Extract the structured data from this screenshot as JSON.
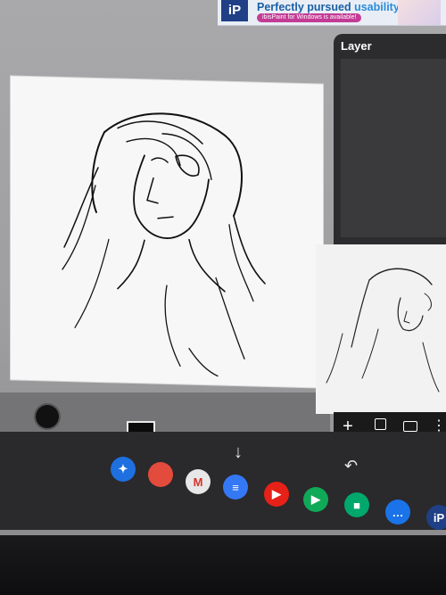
{
  "ad": {
    "logo": "iP",
    "headline": "Perfectly pursued ",
    "headline_accent": "usability!",
    "subline": "ibisPaint for Windows is available!"
  },
  "layer_panel": {
    "title": "Layer",
    "toolbar": {
      "add": "+",
      "more": "⋮"
    }
  },
  "nav": {
    "down": "↓",
    "back": "↶"
  },
  "dock": [
    {
      "name": "assistant",
      "label": "✦",
      "color": "#1e6fe0"
    },
    {
      "name": "chrome",
      "label": "",
      "color": "#e34b3c"
    },
    {
      "name": "gmail",
      "label": "M",
      "color": "#e7e7e7"
    },
    {
      "name": "docs",
      "label": "≡",
      "color": "#3478f6"
    },
    {
      "name": "youtube",
      "label": "▶",
      "color": "#e62117"
    },
    {
      "name": "play-store",
      "label": "▶",
      "color": "#0fa958"
    },
    {
      "name": "google-meet",
      "label": "■",
      "color": "#00a86b"
    },
    {
      "name": "messages",
      "label": "…",
      "color": "#1a73e8"
    },
    {
      "name": "ibispaint",
      "label": "iP",
      "color": "#1f3f86"
    }
  ],
  "colors": {
    "canvas": "#f7f7f7",
    "panel": "#2c2c2e",
    "current_color": "#0b0b0b"
  }
}
